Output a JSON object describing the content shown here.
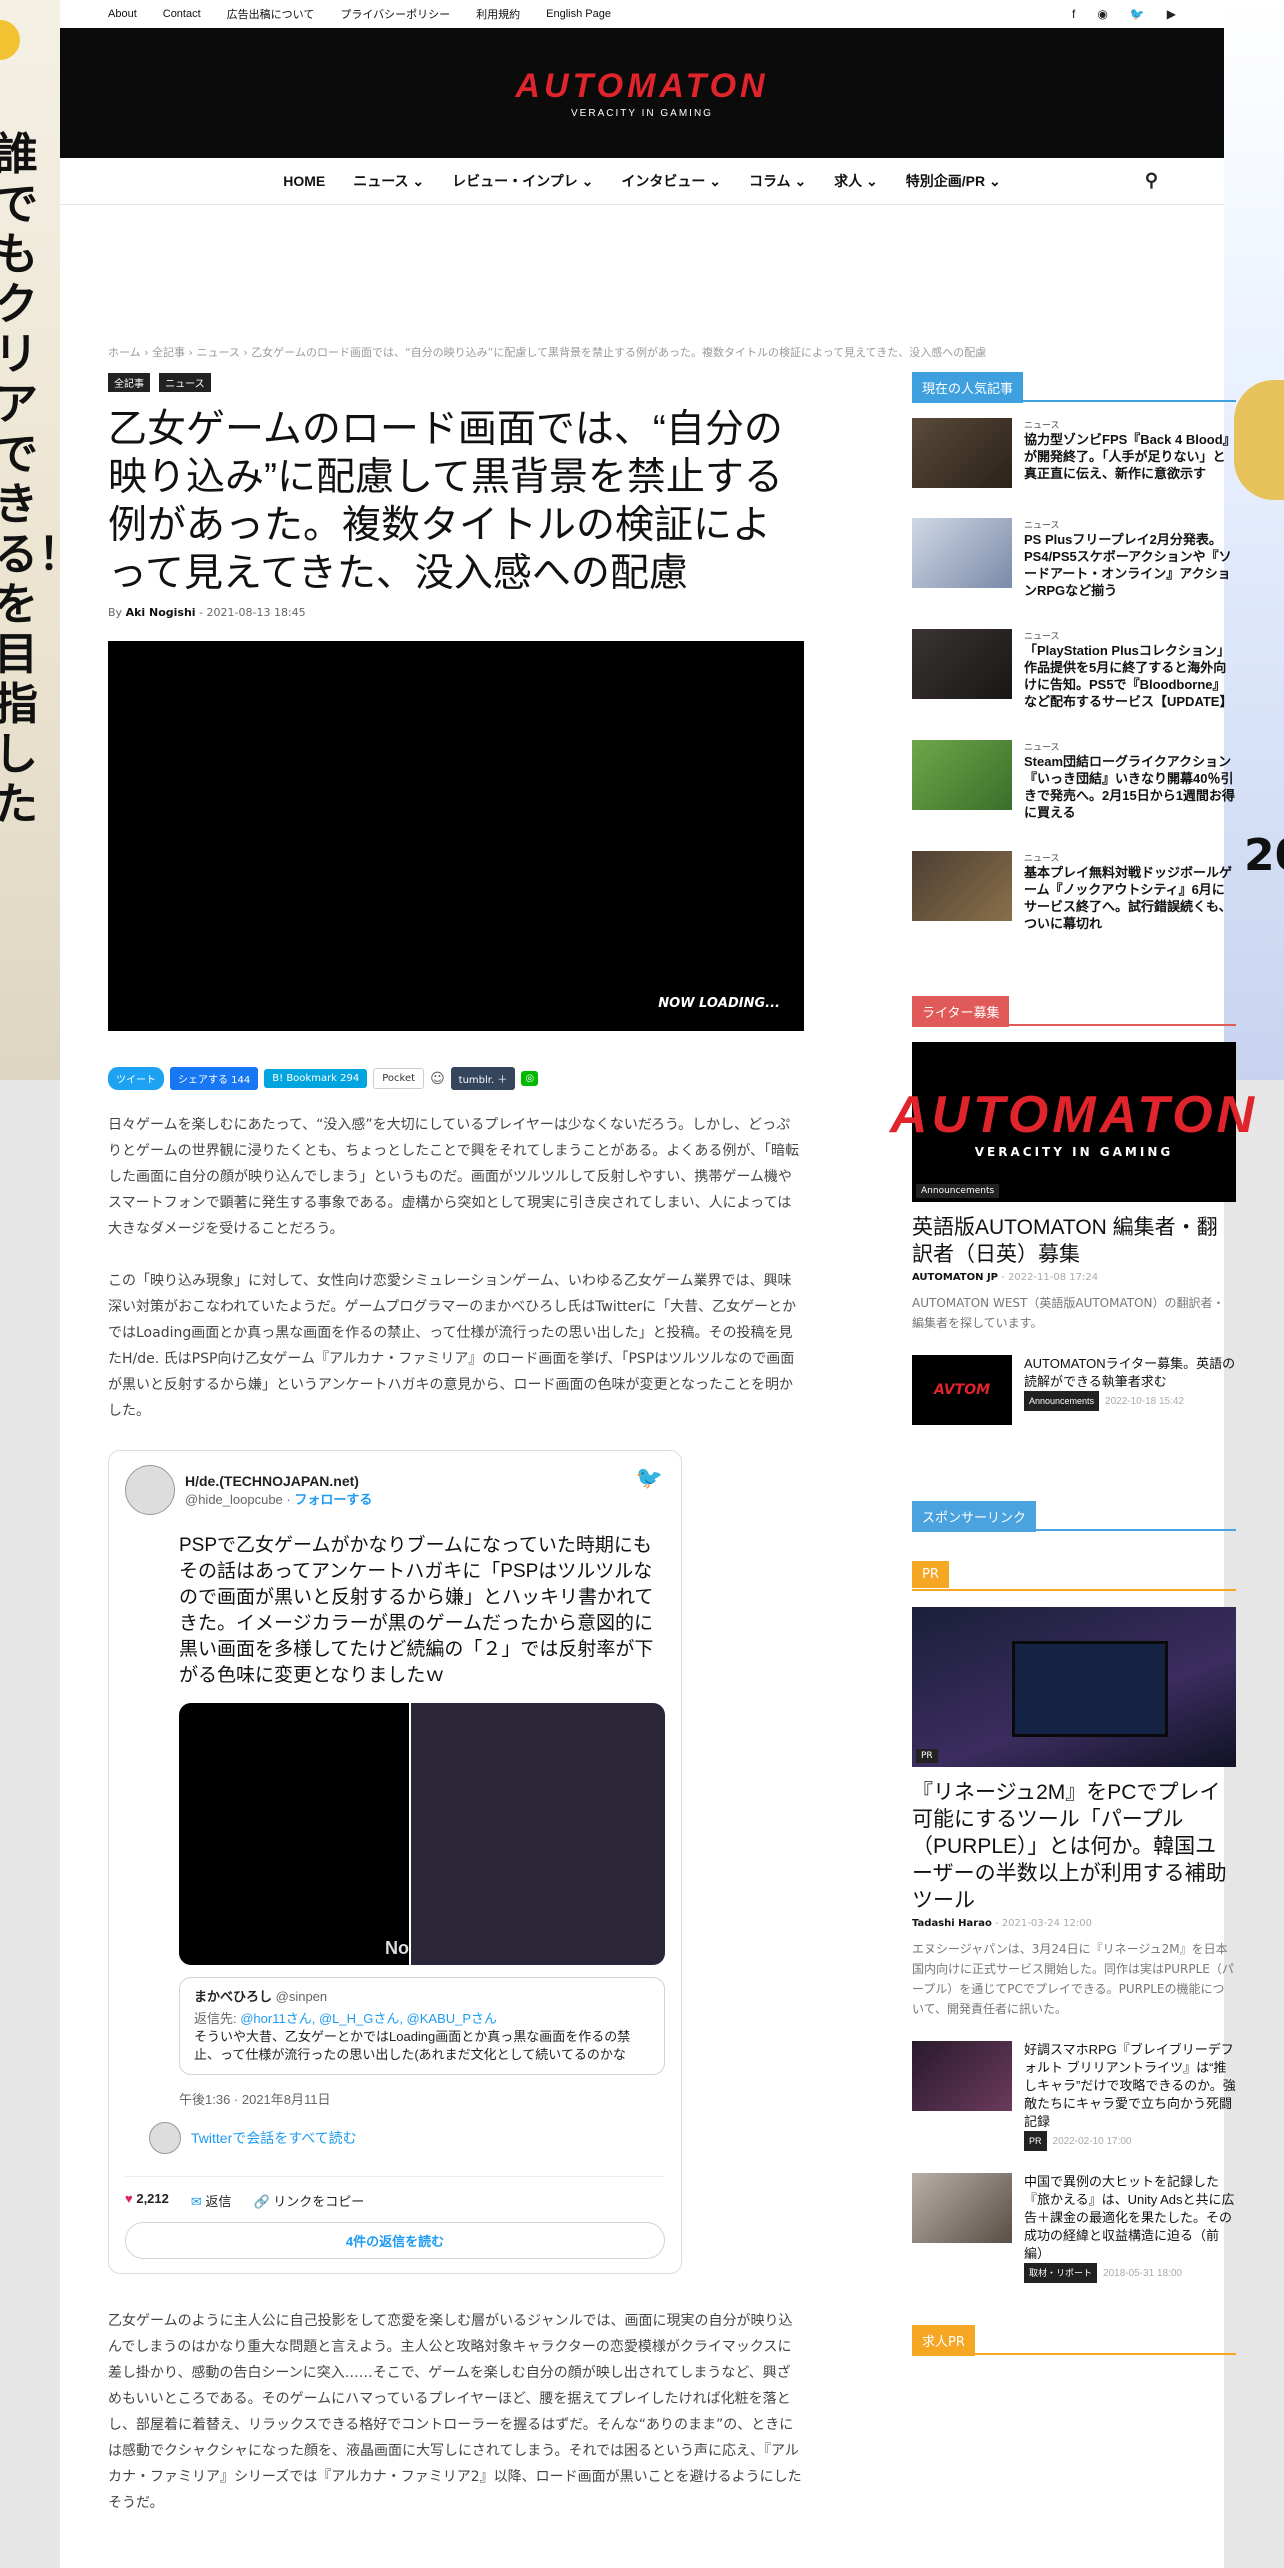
{
  "topbar": {
    "links": [
      "About",
      "Contact",
      "広告出稿について",
      "プライバシーポリシー",
      "利用規約",
      "English Page"
    ],
    "social_icons": [
      "facebook-icon",
      "rss-icon",
      "twitter-icon",
      "youtube-icon"
    ]
  },
  "header": {
    "logo": "AUTOMATON",
    "tagline": "VERACITY IN GAMING"
  },
  "nav": {
    "items": [
      "HOME",
      "ニュース ⌄",
      "レビュー・インプレ ⌄",
      "インタビュー ⌄",
      "コラム ⌄",
      "求人 ⌄",
      "特別企画/PR ⌄"
    ]
  },
  "breadcrumb": "ホーム › 全記事 › ニュース › 乙女ゲームのロード画面では、“自分の映り込み”に配慮して黒背景を禁止する例があった。複数タイトルの検証によって見えてきた、没入感への配慮",
  "article": {
    "tags": [
      "全記事",
      "ニュース"
    ],
    "title": "乙女ゲームのロード画面では、“自分の映り込み”に配慮して黒背景を禁止する例があった。複数タイトルの検証によって見えてきた、没入感への配慮",
    "by": "By",
    "author": "Aki Nogishi",
    "date": "2021-08-13 18:45",
    "video_text": "NOW LOADING...",
    "share": {
      "tweet": "ツイート",
      "facebook": "シェアする 144",
      "hatena": "B! Bookmark 294",
      "pocket": "Pocket",
      "tumblr": "tumblr. ＋"
    },
    "paragraphs": [
      "日々ゲームを楽しむにあたって、“没入感”を大切にしているプレイヤーは少なくないだろう。しかし、どっぷりとゲームの世界観に浸りたくとも、ちょっとしたことで興をそれてしまうことがある。よくある例が、「暗転した画面に自分の顔が映り込んでしまう」というものだ。画面がツルツルして反射しやすい、携帯ゲーム機やスマートフォンで顕著に発生する事象である。虚構から突如として現実に引き戻されてしまい、人によっては大きなダメージを受けることだろう。",
      "この「映り込み現象」に対して、女性向け恋愛シミュレーションゲーム、いわゆる乙女ゲーム業界では、興味深い対策がおこなわれていたようだ。ゲームプログラマーのまかべひろし氏はTwitterに「大昔、乙女ゲーとかではLoading画面とか真っ黒な画面を作るの禁止、って仕様が流行ったの思い出した」と投稿。その投稿を見たH/de. 氏はPSP向け乙女ゲーム『アルカナ・ファミリア』のロード画面を挙げ、「PSPはツルツルなので画面が黒いと反射するから嫌」というアンケートハガキの意見から、ロード画面の色味が変更となったことを明かした。",
      "乙女ゲームのように主人公に自己投影をして恋愛を楽しむ層がいるジャンルでは、画面に現実の自分が映り込んでしまうのはかなり重大な問題と言えよう。主人公と攻略対象キャラクターの恋愛模様がクライマックスに差し掛かり、感動の告白シーンに突入……そこで、ゲームを楽しむ自分の顔が映し出されてしまうなど、興ざめもいいところである。そのゲームにハマっているプレイヤーほど、腰を据えてプレイしたければ化粧を落とし、部屋着に着替え、リラックスできる格好でコントローラーを握るはずだ。そんな“ありのまま”の、ときには感動でクシャクシャになった顔を、液晶画面に大写しにされてしまう。それでは困るという声に応え、『アルカナ・ファミリア』シリーズでは『アルカナ・ファミリア2』以降、ロード画面が黒いことを避けるようにしたそうだ。"
    ]
  },
  "tweet": {
    "name": "H/de.(TECHNOJAPAN.net)",
    "handle": "@hide_loopcube",
    "follow": "フォローする",
    "text": "PSPで乙女ゲームがかなりブームになっていた時期にもその話はあってアンケートハガキに「PSPはツルツルなので画面が黒いと反射するから嫌」とハッキリ書かれてきた。イメージカラーが黒のゲームだったから意図的に黒い画面を多様してたけど続編の「２」では反射率が下がる色味に変更となりましたｗ",
    "image_text": "No",
    "quote_name": "まかべひろし",
    "quote_handle": "@sinpen",
    "quote_reply_prefix": "返信先: ",
    "quote_reply_to": "@hor11さん, @L_H_Gさん, @KABU_Pさん",
    "quote_text": "そういや大昔、乙女ゲーとかではLoading画面とか真っ黒な画面を作るの禁止、って仕様が流行ったの思い出した(あれまだ文化として続いてるのかな",
    "time": "午後1:36 · 2021年8月11日",
    "conversation": "Twitterで会話をすべて読む",
    "likes": "2,212",
    "reply": "返信",
    "copy_link": "リンクをコピー",
    "read_replies": "4件の返信を読む"
  },
  "sidebar": {
    "popular_title": "現在の人気記事",
    "popular": [
      {
        "cat": "ニュース",
        "title": "協力型ゾンビFPS『Back 4 Blood』が開発終了。「人手が足りない」と真正直に伝え、新作に意欲示す"
      },
      {
        "cat": "ニュース",
        "title": "PS Plusフリープレイ2月分発表。PS4/PS5スケボーアクションや『ソードアート・オンライン』アクションRPGなど揃う"
      },
      {
        "cat": "ニュース",
        "title": "「PlayStation Plusコレクション」作品提供を5月に終了すると海外向けに告知。PS5で『Bloodborne』など配布するサービス【UPDATE】"
      },
      {
        "cat": "ニュース",
        "title": "Steam団結ローグライクアクション『いっき団結』いきなり開幕40％引きで発売へ。2月15日から1週間お得に買える"
      },
      {
        "cat": "ニュース",
        "title": "基本プレイ無料対戦ドッジボールゲーム『ノックアウトシティ』6月にサービス終了へ。試行錯誤続くも、ついに幕切れ"
      }
    ],
    "writer_title": "ライター募集",
    "writer_card": {
      "logo": "AUTOMATON",
      "tagline": "VERACITY IN GAMING",
      "badge": "Announcements",
      "title": "英語版AUTOMATON 編集者・翻訳者（日英）募集",
      "author": "AUTOMATON JP",
      "date": "2022-11-08 17:24",
      "excerpt": "AUTOMATON WEST（英語版AUTOMATON）の翻訳者・編集者を探しています。"
    },
    "writer_small": {
      "title": "AUTOMATONライター募集。英語の読解ができる執筆者求む",
      "chip": "Announcements",
      "date": "2022-10-18 15:42"
    },
    "sponsor_title": "スポンサーリンク",
    "pr_title": "PR",
    "pr_card": {
      "badge": "PR",
      "title": "『リネージュ2M』をPCでプレイ可能にするツール「パープル（PURPLE）」とは何か。韓国ユーザーの半数以上が利用する補助ツール",
      "author": "Tadashi Harao",
      "date": "2021-03-24 12:00",
      "excerpt": "エヌシージャパンは、3月24日に『リネージュ2M』を日本国内向けに正式サービス開始した。同作は実はPURPLE（パープル）を通じてPCでプレイできる。PURPLEの機能について、開発責任者に訊いた。"
    },
    "pr_small": [
      {
        "title": "好調スマホRPG『ブレイブリーデフォルト ブリリアントライツ』は“推しキャラ”だけで攻略できるのか。強敵たちにキャラ愛で立ち向かう死闘記録",
        "chip": "PR",
        "date": "2022-02-10 17:00"
      },
      {
        "title": "中国で異例の大ヒットを記録した『旅かえる』は、Unity Adsと共に広告＋課金の最適化を果たした。その成功の経緯と収益構造に迫る（前編）",
        "chip": "取材・リポート",
        "date": "2018-05-31 18:00"
      }
    ],
    "job_title": "求人PR"
  },
  "ads": {
    "left_text": "誰でもクリアできる！を目指した",
    "right_text": "20"
  },
  "colors": {
    "accent": "#e0242c",
    "popular_blue": "#3fa0e0",
    "writer_red": "#e05a5a",
    "sponsor_blue": "#4aa3df",
    "pr_orange": "#f5a623",
    "twitter_blue": "#1d9bf0"
  }
}
